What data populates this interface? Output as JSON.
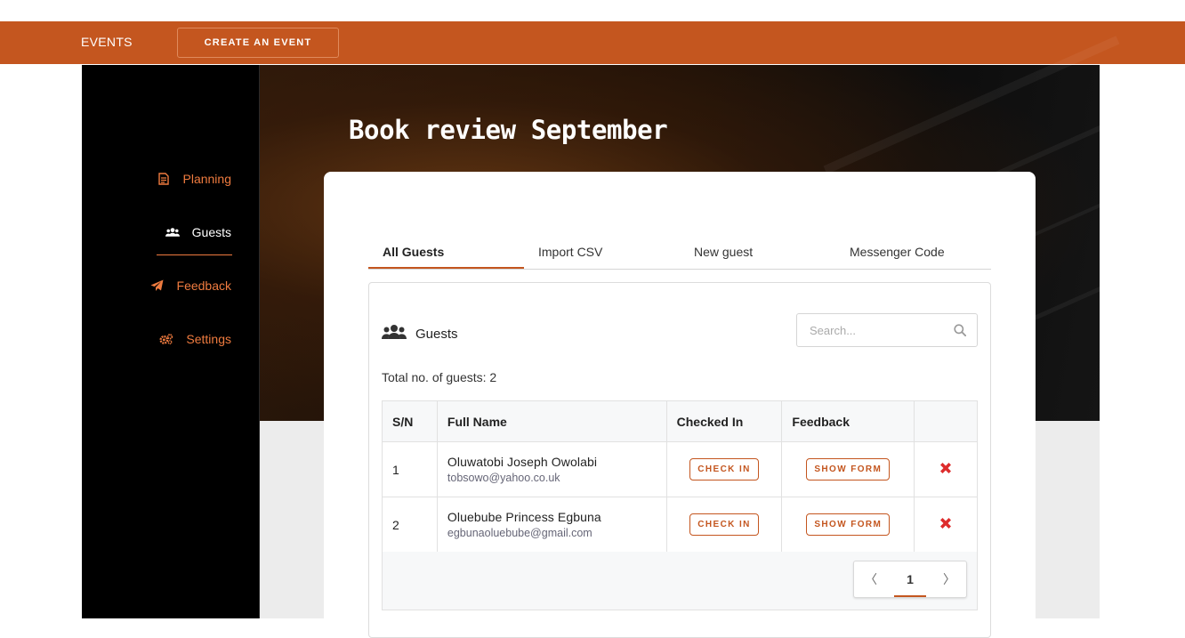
{
  "topbar": {
    "brand": "EVENTS",
    "create_button": "CREATE AN EVENT",
    "accent_color": "#c4561f"
  },
  "sidebar": {
    "items": [
      {
        "label": "Planning",
        "icon": "document-icon",
        "active": false
      },
      {
        "label": "Guests",
        "icon": "users-icon",
        "active": true
      },
      {
        "label": "Feedback",
        "icon": "paper-plane-icon",
        "active": false
      },
      {
        "label": "Settings",
        "icon": "gears-icon",
        "active": false
      }
    ]
  },
  "event": {
    "title": "Book review September"
  },
  "tabs": [
    {
      "label": "All Guests",
      "active": true
    },
    {
      "label": "Import CSV",
      "active": false
    },
    {
      "label": "New guest",
      "active": false
    },
    {
      "label": "Messenger Code",
      "active": false
    }
  ],
  "guests_panel": {
    "heading": "Guests",
    "search_placeholder": "Search...",
    "total_text": "Total no. of guests: 2",
    "columns": [
      "S/N",
      "Full Name",
      "Checked In",
      "Feedback",
      ""
    ],
    "rows": [
      {
        "sn": "1",
        "name": "Oluwatobi Joseph Owolabi",
        "email": "tobsowo@yahoo.co.uk",
        "check_in": "CHECK IN",
        "feedback": "SHOW FORM"
      },
      {
        "sn": "2",
        "name": "Oluebube Princess Egbuna",
        "email": "egbunaoluebube@gmail.com",
        "check_in": "CHECK IN",
        "feedback": "SHOW FORM"
      }
    ],
    "pagination": {
      "prev": "〈",
      "current": "1",
      "next": "〉"
    }
  }
}
